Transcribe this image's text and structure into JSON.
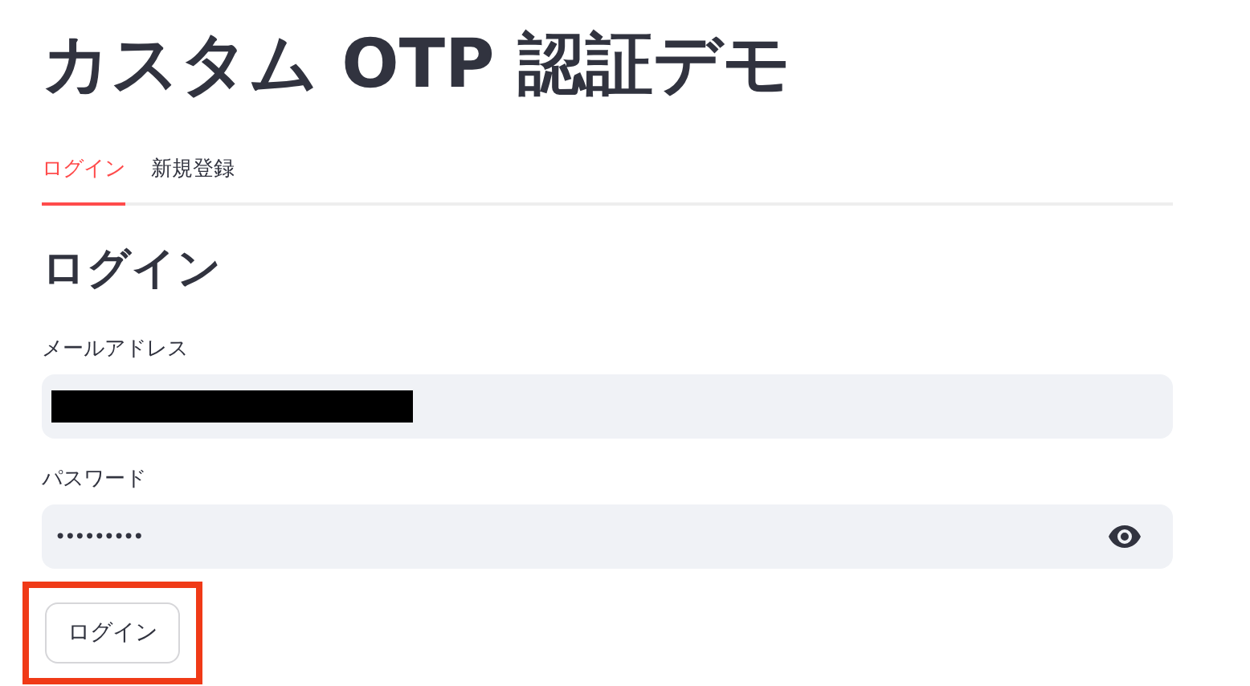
{
  "title": "カスタム OTP 認証デモ",
  "tabs": [
    {
      "label": "ログイン",
      "selected": true
    },
    {
      "label": "新規登録",
      "selected": false
    }
  ],
  "form": {
    "heading": "ログイン",
    "fields": [
      {
        "kind": "email",
        "label": "メールアドレス",
        "redacted": true
      },
      {
        "kind": "password",
        "label": "パスワード",
        "value": "•••••••••"
      }
    ],
    "submit": {
      "label": "ログイン",
      "highlighted": true
    }
  }
}
